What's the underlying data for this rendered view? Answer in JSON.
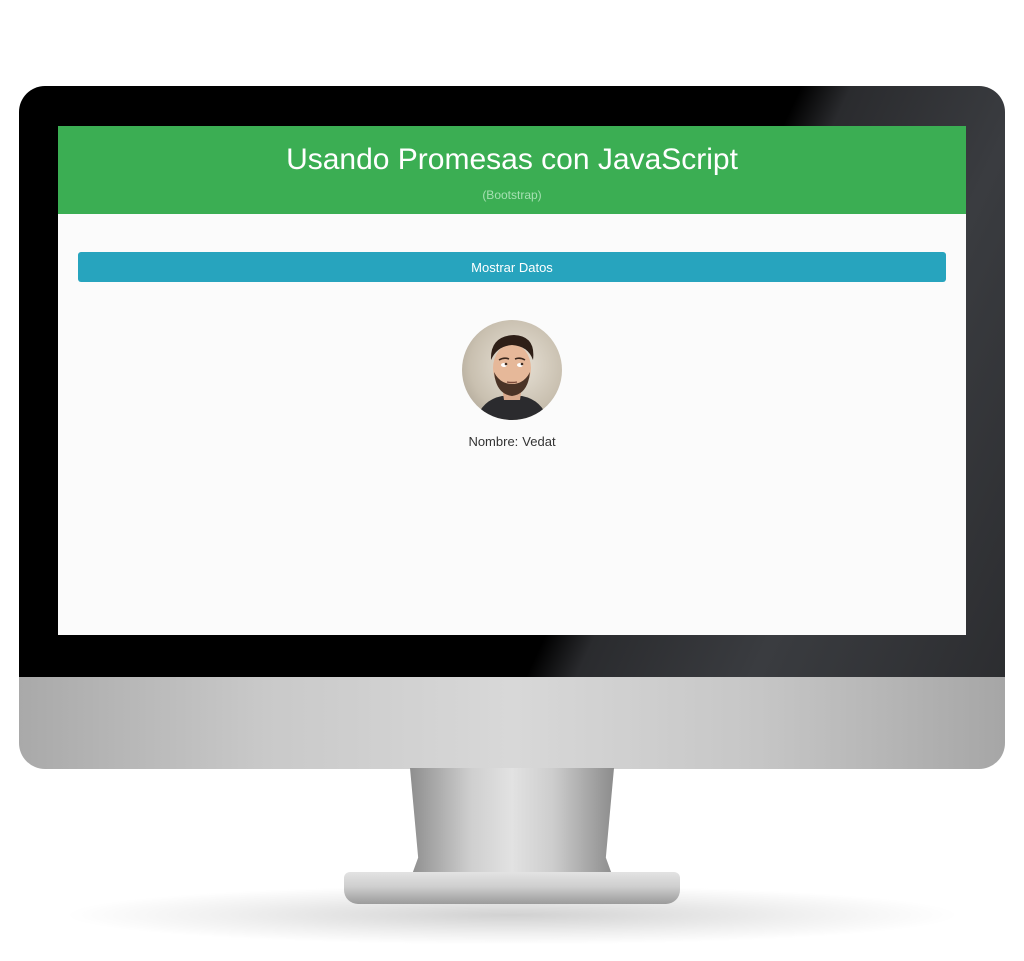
{
  "header": {
    "title": "Usando Promesas con JavaScript",
    "subtitle": "(Bootstrap)"
  },
  "main": {
    "button_label": "Mostrar Datos",
    "avatar_icon": "user-photo-icon",
    "name_label": "Nombre:",
    "name_value": "Vedat"
  },
  "colors": {
    "header_bg": "#3bae53",
    "button_bg": "#27a4be",
    "screen_bg": "#fbfbfb"
  }
}
